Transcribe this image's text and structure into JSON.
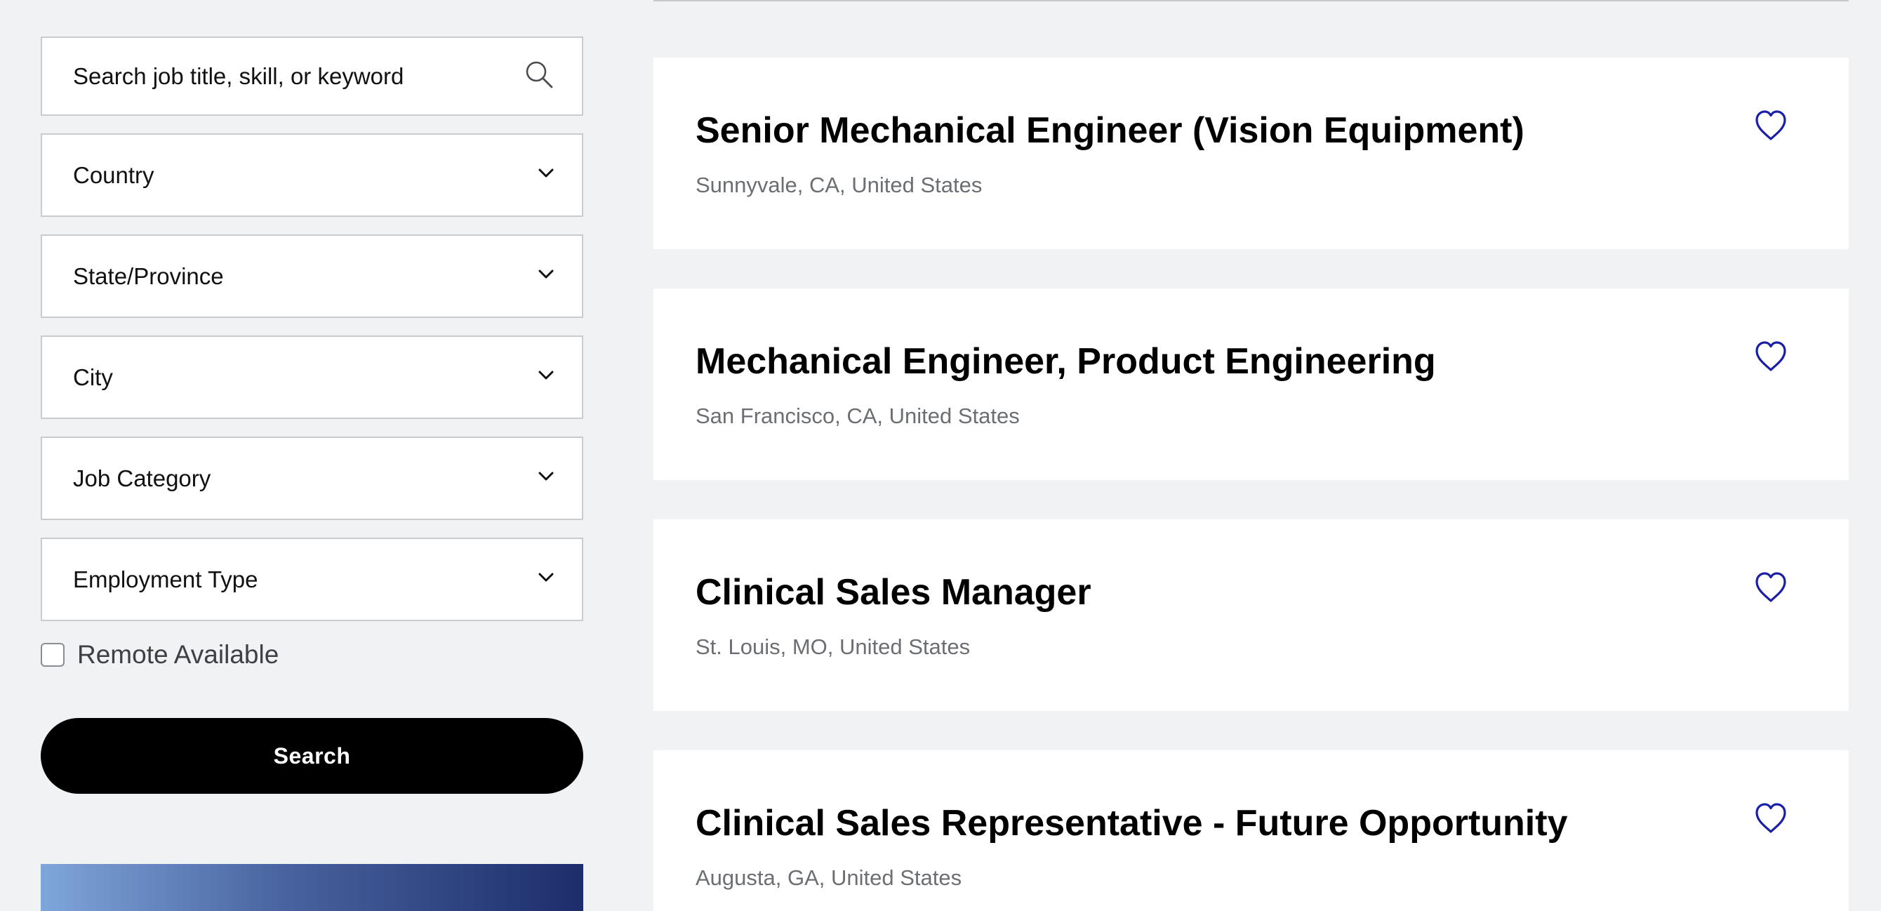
{
  "filters": {
    "search_placeholder": "Search job title, skill, or keyword",
    "country": "Country",
    "state": "State/Province",
    "city": "City",
    "job_category": "Job Category",
    "employment_type": "Employment Type",
    "remote_label": "Remote Available",
    "remote_checked": false,
    "search_button": "Search"
  },
  "jobs": [
    {
      "title": "Senior Mechanical Engineer (Vision Equipment)",
      "location": "Sunnyvale, CA, United States"
    },
    {
      "title": "Mechanical Engineer, Product Engineering",
      "location": "San Francisco, CA, United States"
    },
    {
      "title": "Clinical Sales Manager",
      "location": "St. Louis, MO, United States"
    },
    {
      "title": "Clinical Sales Representative - Future Opportunity",
      "location": "Augusta, GA, United States"
    }
  ],
  "colors": {
    "page_background": "#f1f2f4",
    "heart_icon": "#1a1fa8",
    "button_background": "#000000",
    "location_text": "#6b6e73"
  },
  "icons": {
    "search": "search-icon",
    "dropdown": "chevron-down-icon",
    "favorite": "heart-outline-icon"
  }
}
